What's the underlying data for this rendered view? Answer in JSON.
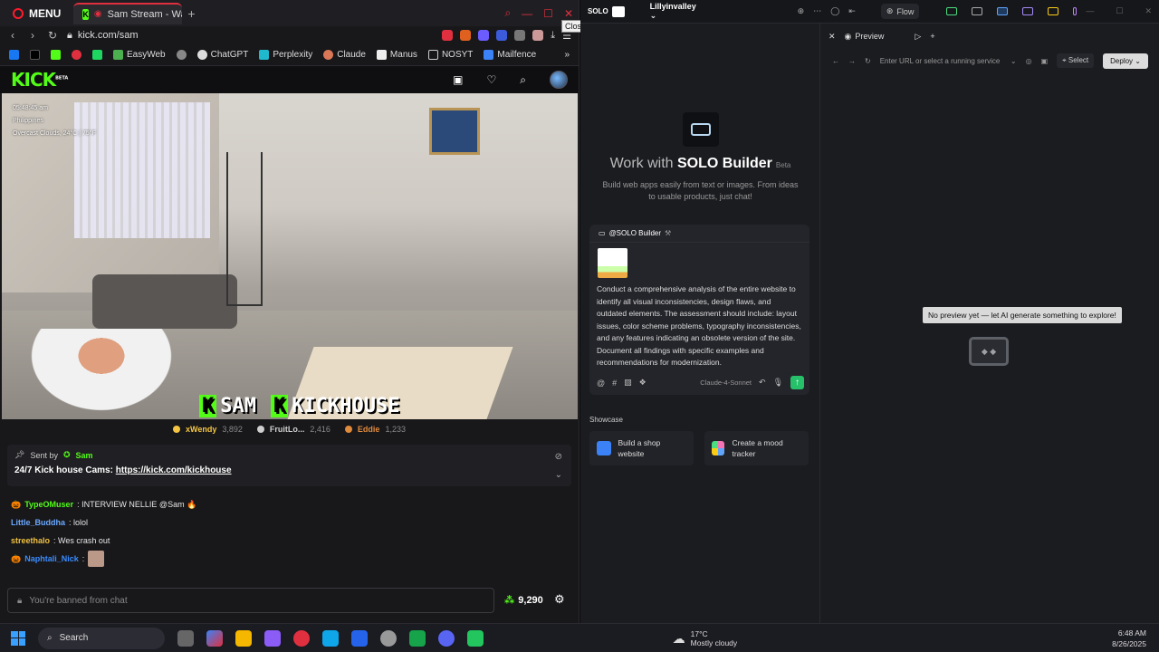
{
  "browser": {
    "menu_label": "MENU",
    "tab_title": "Sam Stream - Watch L",
    "close_tooltip": "Close",
    "url": "kick.com/sam",
    "bookmarks": [
      "EasyWeb",
      "ChatGPT",
      "Perplexity",
      "Claude",
      "Manus",
      "NOSYT",
      "Mailfence"
    ]
  },
  "kick": {
    "logo": "KICK",
    "logo_sup": "BETA",
    "video": {
      "time": "05:48:45 am",
      "location": "Philippines",
      "weather": "Overcast Clouds, 24°C | 75°F",
      "overlay_left": "SAM",
      "overlay_right": "KICKHOUSE"
    },
    "leaderboard": [
      {
        "name": "xWendy",
        "count": "3,892",
        "color": "#f5c542"
      },
      {
        "name": "FruitLo...",
        "count": "2,416",
        "color": "#cfcfcf"
      },
      {
        "name": "Eddie",
        "count": "1,233",
        "color": "#e08a3c"
      }
    ],
    "pinned": {
      "sent_by": "Sent by",
      "user": "Sam",
      "text": "24/7 Kick house Cams:",
      "link": "https://kick.com/kickhouse"
    },
    "chat": [
      {
        "user": "TypeOMuser",
        "color": "#53fc18",
        "text": ": INTERVIEW NELLIE @Sam 🔥"
      },
      {
        "user": "Little_Buddha",
        "color": "#6aa8ff",
        "text": ": lolol"
      },
      {
        "user": "streethalo",
        "color": "#f0c040",
        "text": ": Wes crash out"
      },
      {
        "user": "Naphtali_Nick",
        "color": "#3a8cff",
        "text": ":"
      }
    ],
    "chat_placeholder": "You're banned from chat",
    "points": "9,290"
  },
  "solo": {
    "logo": "SOLO",
    "project": "Lillyinvalley",
    "flow": "Flow",
    "hero_prefix": "Work with ",
    "hero_brand": "SOLO Builder",
    "hero_beta": "Beta",
    "hero_sub": "Build web apps easily from text or images. From ideas to usable products, just chat!",
    "card_head": "@SOLO Builder",
    "prompt": "Conduct a comprehensive analysis of the entire website to identify all visual inconsistencies, design flaws, and outdated elements. The assessment should include: layout issues, color scheme problems, typography inconsistencies, and any features indicating an obsolete version of the site. Document all findings with specific examples and recommendations for modernization.",
    "model": "Claude-4-Sonnet",
    "showcase_label": "Showcase",
    "showcase": [
      "Build a shop website",
      "Create a mood tracker"
    ],
    "preview_tab": "Preview",
    "url_placeholder": "Enter URL or select a running service",
    "select_label": "Select",
    "deploy_label": "Deploy",
    "no_preview": "No preview yet — let AI generate something to explore!"
  },
  "taskbar": {
    "search": "Search",
    "temp": "17°C",
    "condition": "Mostly cloudy",
    "time": "6:48 AM",
    "date": "8/26/2025"
  }
}
